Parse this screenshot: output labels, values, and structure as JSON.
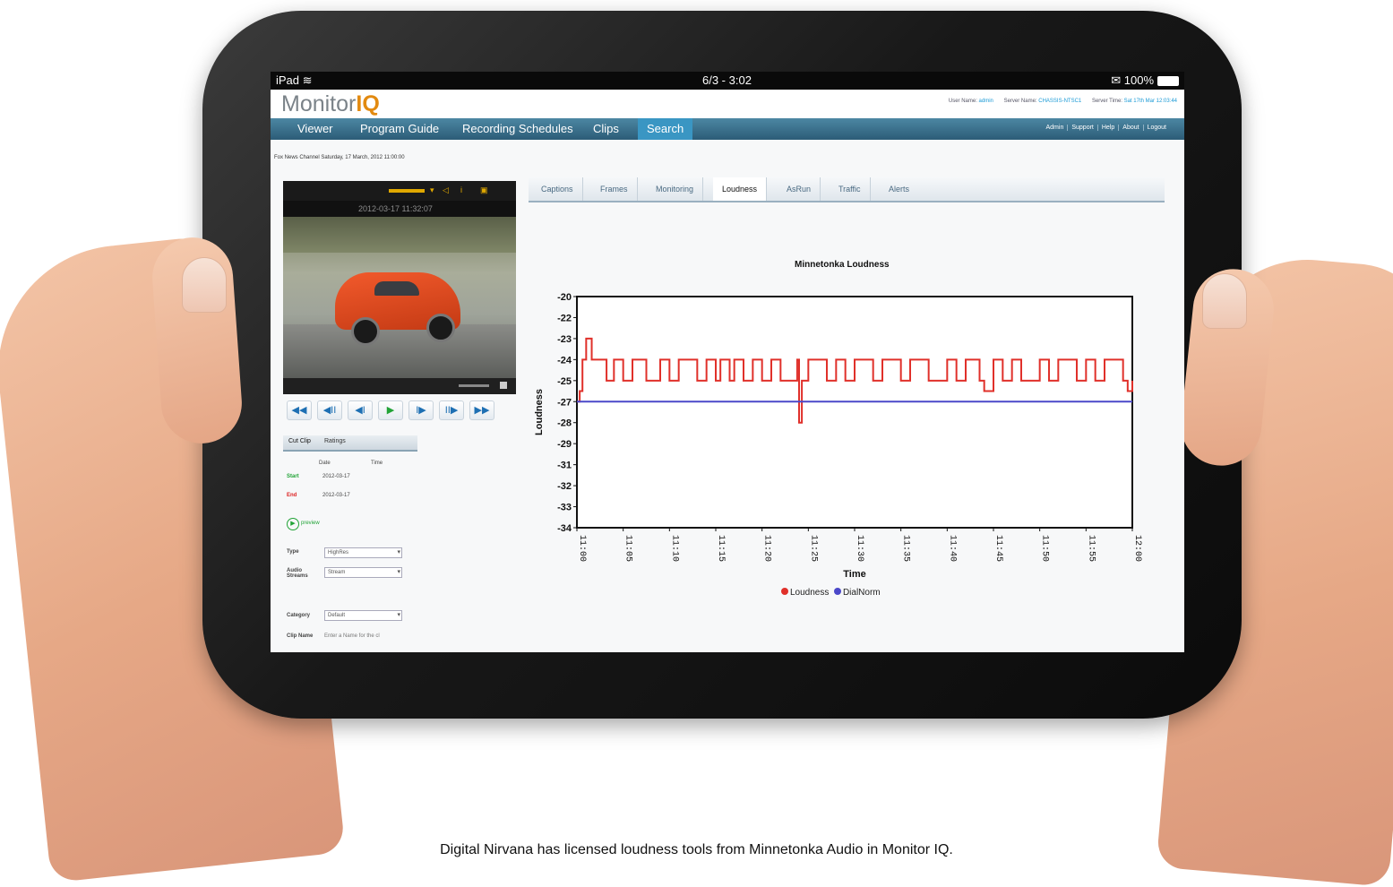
{
  "statusbar": {
    "device": "iPad",
    "time": "6/3 - 3:02",
    "battery": "100%"
  },
  "header": {
    "logo_main": "Monitor",
    "logo_accent": "IQ",
    "user_label": "User Name:",
    "user_value": "admin",
    "server_label": "Server Name:",
    "server_value": "CHASSIS-NTSC1",
    "time_label": "Server Time:",
    "time_value": "Sat 17th Mar 12:03:44"
  },
  "nav": {
    "items": [
      "Viewer",
      "Program Guide",
      "Recording Schedules",
      "Clips",
      "Search"
    ],
    "active": "Search",
    "right": [
      "Admin",
      "Support",
      "Help",
      "About",
      "Logout"
    ]
  },
  "program_info": "Fox News Channel Saturday, 17 March, 2012 11:00:00",
  "video": {
    "timestamp": "2012-03-17 11:32:07"
  },
  "controls": [
    "◀◀",
    "◀II",
    "◀I",
    "▶",
    "I▶",
    "II▶",
    "▶▶"
  ],
  "clip_panel": {
    "tabs": [
      "Cut Clip",
      "Ratings"
    ],
    "col_date": "Date",
    "col_time": "Time",
    "start_label": "Start",
    "start_date": "2012-03-17",
    "end_label": "End",
    "end_date": "2012-03-17",
    "preview_label": "preview",
    "type_label": "Type",
    "type_value": "HighRes",
    "audio_label": "Audio Streams",
    "audio_value": "Stream",
    "category_label": "Category",
    "category_value": "Default",
    "clipname_label": "Clip Name",
    "clipname_placeholder": "Enter a Name for the cl"
  },
  "analysis_tabs": [
    "Captions",
    "Frames",
    "Monitoring",
    "Loudness",
    "AsRun",
    "Traffic",
    "Alerts"
  ],
  "analysis_active": "Loudness",
  "chart_data": {
    "type": "line",
    "title": "Minnetonka Loudness",
    "xlabel": "Time",
    "ylabel": "Loudness",
    "x_ticks": [
      "11:00",
      "11:05",
      "11:10",
      "11:15",
      "11:20",
      "11:25",
      "11:30",
      "11:35",
      "11:40",
      "11:45",
      "11:50",
      "11:55",
      "12:00"
    ],
    "y_ticks": [
      -20,
      -22,
      -23,
      -24,
      -25,
      -27,
      -28,
      -29,
      -31,
      -32,
      -33,
      -34
    ],
    "ylim": [
      -34,
      -20
    ],
    "series": [
      {
        "name": "Loudness",
        "color": "#e0302a",
        "x": [
          0,
          0.3,
          0.6,
          1,
          1.6,
          2.4,
          3.2,
          4.0,
          5.0,
          6.0,
          7.5,
          9.0,
          10.0,
          11.0,
          12.0,
          13.0,
          14.0,
          14.5,
          15.0,
          15.5,
          16.0,
          16.5,
          17.0,
          18.0,
          19.0,
          20.0,
          21.0,
          22.0,
          23.0,
          23.8,
          24.0,
          24.3,
          25.0,
          26.0,
          27.0,
          28.0,
          29.0,
          30.0,
          31.0,
          32.0,
          33.0,
          34.0,
          35.0,
          36.0,
          37.0,
          38.0,
          39.0,
          40.0,
          41.0,
          42.0,
          43.0,
          43.5,
          44.0,
          45.0,
          46.0,
          47.0,
          48.0,
          49.0,
          50.0,
          51.0,
          52.0,
          53.0,
          54.0,
          55.0,
          56.0,
          57.0,
          58.0,
          59.0,
          59.5,
          60.0
        ],
        "y": [
          -27,
          -26,
          -24,
          -23,
          -24,
          -24,
          -25,
          -24,
          -25,
          -24,
          -25,
          -24,
          -25,
          -24,
          -24,
          -25,
          -24,
          -24,
          -25,
          -24,
          -24,
          -25,
          -24,
          -25,
          -24,
          -25,
          -24,
          -25,
          -25,
          -24,
          -28,
          -25,
          -24,
          -24,
          -25,
          -24,
          -25,
          -24,
          -24,
          -25,
          -24,
          -24,
          -25,
          -24,
          -24,
          -25,
          -25,
          -24,
          -25,
          -24,
          -24,
          -25,
          -26,
          -24,
          -25,
          -24,
          -25,
          -25,
          -24,
          -25,
          -24,
          -24,
          -25,
          -24,
          -25,
          -24,
          -24,
          -25,
          -26,
          -25
        ]
      },
      {
        "name": "DialNorm",
        "color": "#4b48c9",
        "x": [
          0,
          60
        ],
        "y": [
          -27,
          -27
        ]
      }
    ],
    "legend": "bottom"
  },
  "footer": "Digital Nirvana has licensed loudness tools from Minnetonka Audio in Monitor IQ."
}
